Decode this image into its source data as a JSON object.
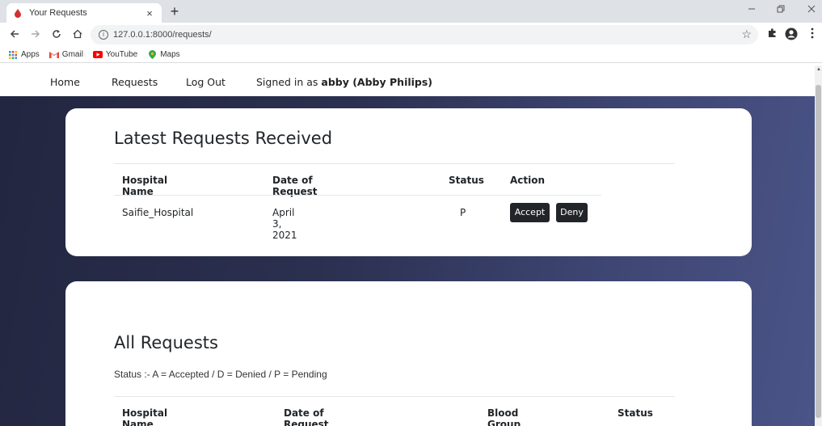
{
  "browser": {
    "tab_title": "Your Requests",
    "tab_close": "×",
    "new_tab": "+",
    "url": "127.0.0.1:8000/requests/",
    "bookmarks": [
      {
        "label": "Apps",
        "icon": "apps-grid-icon"
      },
      {
        "label": "Gmail",
        "icon": "gmail-icon"
      },
      {
        "label": "YouTube",
        "icon": "youtube-icon"
      },
      {
        "label": "Maps",
        "icon": "maps-pin-icon"
      }
    ],
    "colors": {
      "tabbar": "#dee1e6",
      "omnibox": "#f1f3f4"
    }
  },
  "nav": {
    "home": "Home",
    "requests": "Requests",
    "logout": "Log Out",
    "signed_in_prefix": "Signed in as",
    "signed_in_user": "abby (Abby Philips)"
  },
  "latest": {
    "title": "Latest Requests Received",
    "columns": [
      "Hospital Name",
      "Date of Request",
      "Status",
      "Action"
    ],
    "rows": [
      {
        "hospital": "Saifie_Hospital",
        "date": "April 3, 2021",
        "status": "P",
        "accept": "Accept",
        "deny": "Deny"
      }
    ]
  },
  "all": {
    "title": "All Requests",
    "legend": "Status :-  A = Accepted  /  D = Denied  /  P = Pending",
    "columns": [
      "Hospital Name",
      "Date of Request",
      "Blood Group",
      "Status"
    ]
  },
  "colors": {
    "hero_gradient_start": "#222640",
    "hero_gradient_end": "#4a5487",
    "button": "#212529",
    "card": "#ffffff"
  }
}
